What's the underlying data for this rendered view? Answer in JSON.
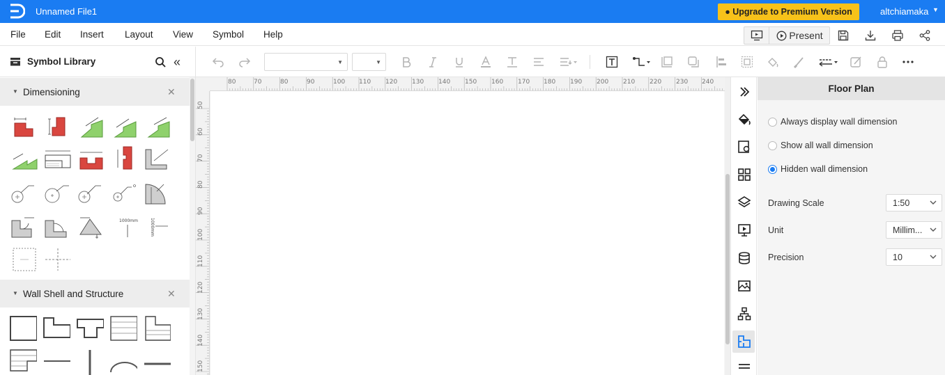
{
  "app": {
    "file_title": "Unnamed File1",
    "upgrade_label": "● Upgrade to Premium Version",
    "user_name": "altchiamaka",
    "accent_color": "#1a7cf2",
    "upgrade_color": "#f7c21a"
  },
  "menu": {
    "items": [
      "File",
      "Edit",
      "Insert",
      "Layout",
      "View",
      "Symbol",
      "Help"
    ],
    "present_label": "Present"
  },
  "library": {
    "title": "Symbol Library",
    "categories": [
      {
        "title": "Dimensioning"
      },
      {
        "title": "Wall Shell and Structure"
      }
    ],
    "symbol_texts": {
      "mm_label": "1000mm",
      "mm_label_vertical": "1000mm"
    }
  },
  "ruler": {
    "top": [
      "80",
      "70",
      "80",
      "90",
      "100",
      "110",
      "120",
      "130",
      "140",
      "150",
      "160",
      "170",
      "180",
      "190",
      "200",
      "210",
      "220",
      "230",
      "240"
    ],
    "left": [
      "50",
      "60",
      "70",
      "80",
      "90",
      "100",
      "110",
      "120",
      "130",
      "140",
      "150"
    ]
  },
  "props": {
    "title": "Floor Plan",
    "radios": [
      {
        "label": "Always display wall dimension",
        "checked": false
      },
      {
        "label": "Show all wall dimension",
        "checked": false
      },
      {
        "label": "Hidden wall dimension",
        "checked": true
      }
    ],
    "drawing_scale": {
      "label": "Drawing Scale",
      "value": "1:50"
    },
    "unit": {
      "label": "Unit",
      "value": "Millim..."
    },
    "precision": {
      "label": "Precision",
      "value": "10"
    }
  }
}
